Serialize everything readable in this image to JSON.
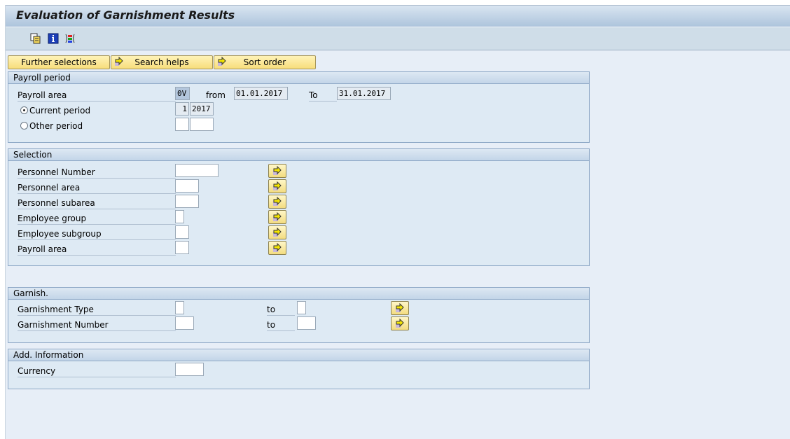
{
  "window": {
    "title": "Evaluation of Garnishment Results"
  },
  "toolbar": {
    "icons": [
      {
        "name": "copy-variant-icon",
        "tooltip": ""
      },
      {
        "name": "info-icon",
        "tooltip": ""
      },
      {
        "name": "selection-options-icon",
        "tooltip": ""
      }
    ]
  },
  "buttons": {
    "further_selections": "Further selections",
    "search_helps": "Search helps",
    "sort_order": "Sort order"
  },
  "payroll_period": {
    "heading": "Payroll period",
    "payroll_area_label": "Payroll area",
    "payroll_area_value": "0V",
    "from_label": "from",
    "from_value": "01.01.2017",
    "to_label": "To",
    "to_value": "31.01.2017",
    "current_period_label": "Current period",
    "current_period_selected": true,
    "current_period_number": "1",
    "current_period_year": "2017",
    "other_period_label": "Other period",
    "other_period_selected": false,
    "other_period_number": "",
    "other_period_year": ""
  },
  "selection": {
    "heading": "Selection",
    "fields": [
      {
        "label": "Personnel Number",
        "value": ""
      },
      {
        "label": "Personnel area",
        "value": ""
      },
      {
        "label": "Personnel subarea",
        "value": ""
      },
      {
        "label": "Employee group",
        "value": ""
      },
      {
        "label": "Employee subgroup",
        "value": ""
      },
      {
        "label": "Payroll area",
        "value": ""
      }
    ]
  },
  "garnish": {
    "heading": "Garnish.",
    "to_label": "to",
    "fields": [
      {
        "label": "Garnishment Type",
        "from": "",
        "to": ""
      },
      {
        "label": "Garnishment Number",
        "from": "",
        "to": ""
      }
    ]
  },
  "add_info": {
    "heading": "Add. Information",
    "currency_label": "Currency",
    "currency_value": ""
  }
}
